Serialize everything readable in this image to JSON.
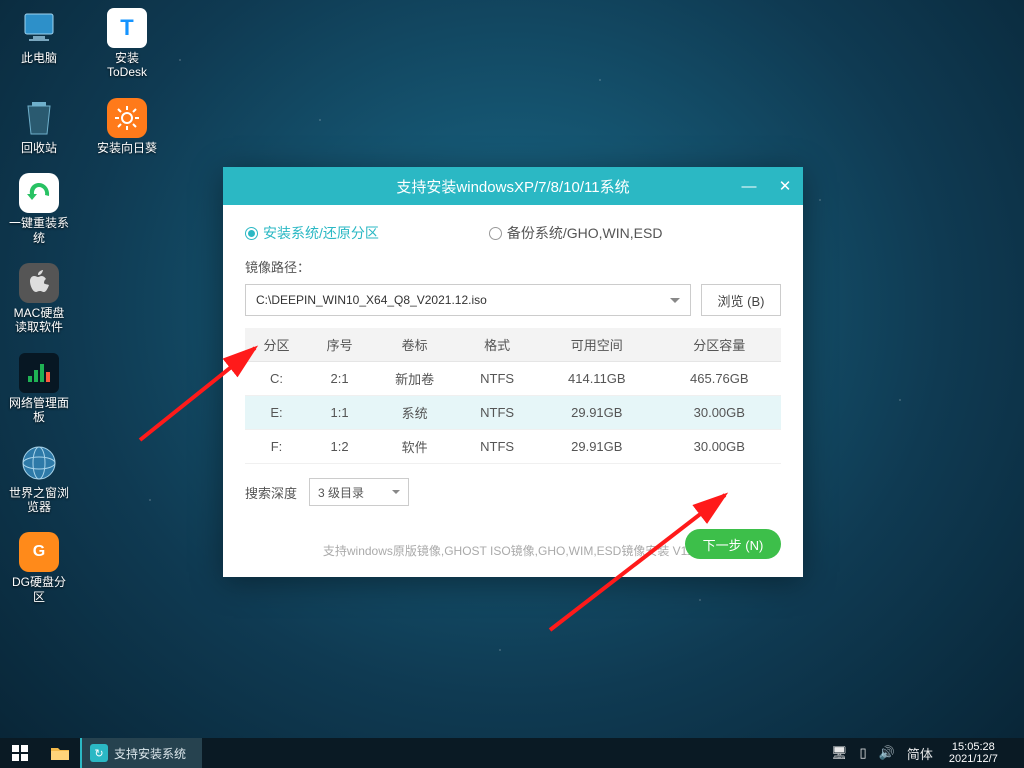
{
  "desktop": {
    "icons": [
      [
        {
          "label": "此电脑",
          "id": "this-pc"
        },
        {
          "label": "安装ToDesk",
          "id": "install-todesk"
        }
      ],
      [
        {
          "label": "回收站",
          "id": "recycle-bin"
        },
        {
          "label": "安装向日葵",
          "id": "install-sunlogin"
        }
      ],
      [
        {
          "label": "一键重装系统",
          "id": "one-click-reinstall"
        }
      ],
      [
        {
          "label": "MAC硬盘读取软件",
          "id": "mac-disk-reader"
        }
      ],
      [
        {
          "label": "网络管理面板",
          "id": "network-panel"
        }
      ],
      [
        {
          "label": "世界之窗浏览器",
          "id": "theworld-browser"
        }
      ],
      [
        {
          "label": "DG硬盘分区",
          "id": "dg-partition"
        }
      ]
    ]
  },
  "dialog": {
    "title": "支持安装windowsXP/7/8/10/11系统",
    "tab_install": "安装系统/还原分区",
    "tab_backup": "备份系统/GHO,WIN,ESD",
    "path_label": "镜像路径：",
    "path_value": "C:\\DEEPIN_WIN10_X64_Q8_V2021.12.iso",
    "browse": "浏览 (B)",
    "columns": [
      "分区",
      "序号",
      "卷标",
      "格式",
      "可用空间",
      "分区容量"
    ],
    "rows": [
      {
        "part": "C:",
        "idx": "2:1",
        "vol": "新加卷",
        "fmt": "NTFS",
        "free": "414.11GB",
        "cap": "465.76GB",
        "selected": false
      },
      {
        "part": "E:",
        "idx": "1:1",
        "vol": "系统",
        "fmt": "NTFS",
        "free": "29.91GB",
        "cap": "30.00GB",
        "selected": true
      },
      {
        "part": "F:",
        "idx": "1:2",
        "vol": "软件",
        "fmt": "NTFS",
        "free": "29.91GB",
        "cap": "30.00GB",
        "selected": false
      }
    ],
    "search_label": "搜索深度",
    "search_depth": "3 级目录",
    "next": "下一步 (N)",
    "hint": "支持windows原版镜像,GHOST ISO镜像,GHO,WIM,ESD镜像安装 V11.0"
  },
  "taskbar": {
    "task_label": "支持安装系统"
  },
  "tray": {
    "ime": "简体",
    "time": "15:05:28",
    "date": "2021/12/7"
  }
}
